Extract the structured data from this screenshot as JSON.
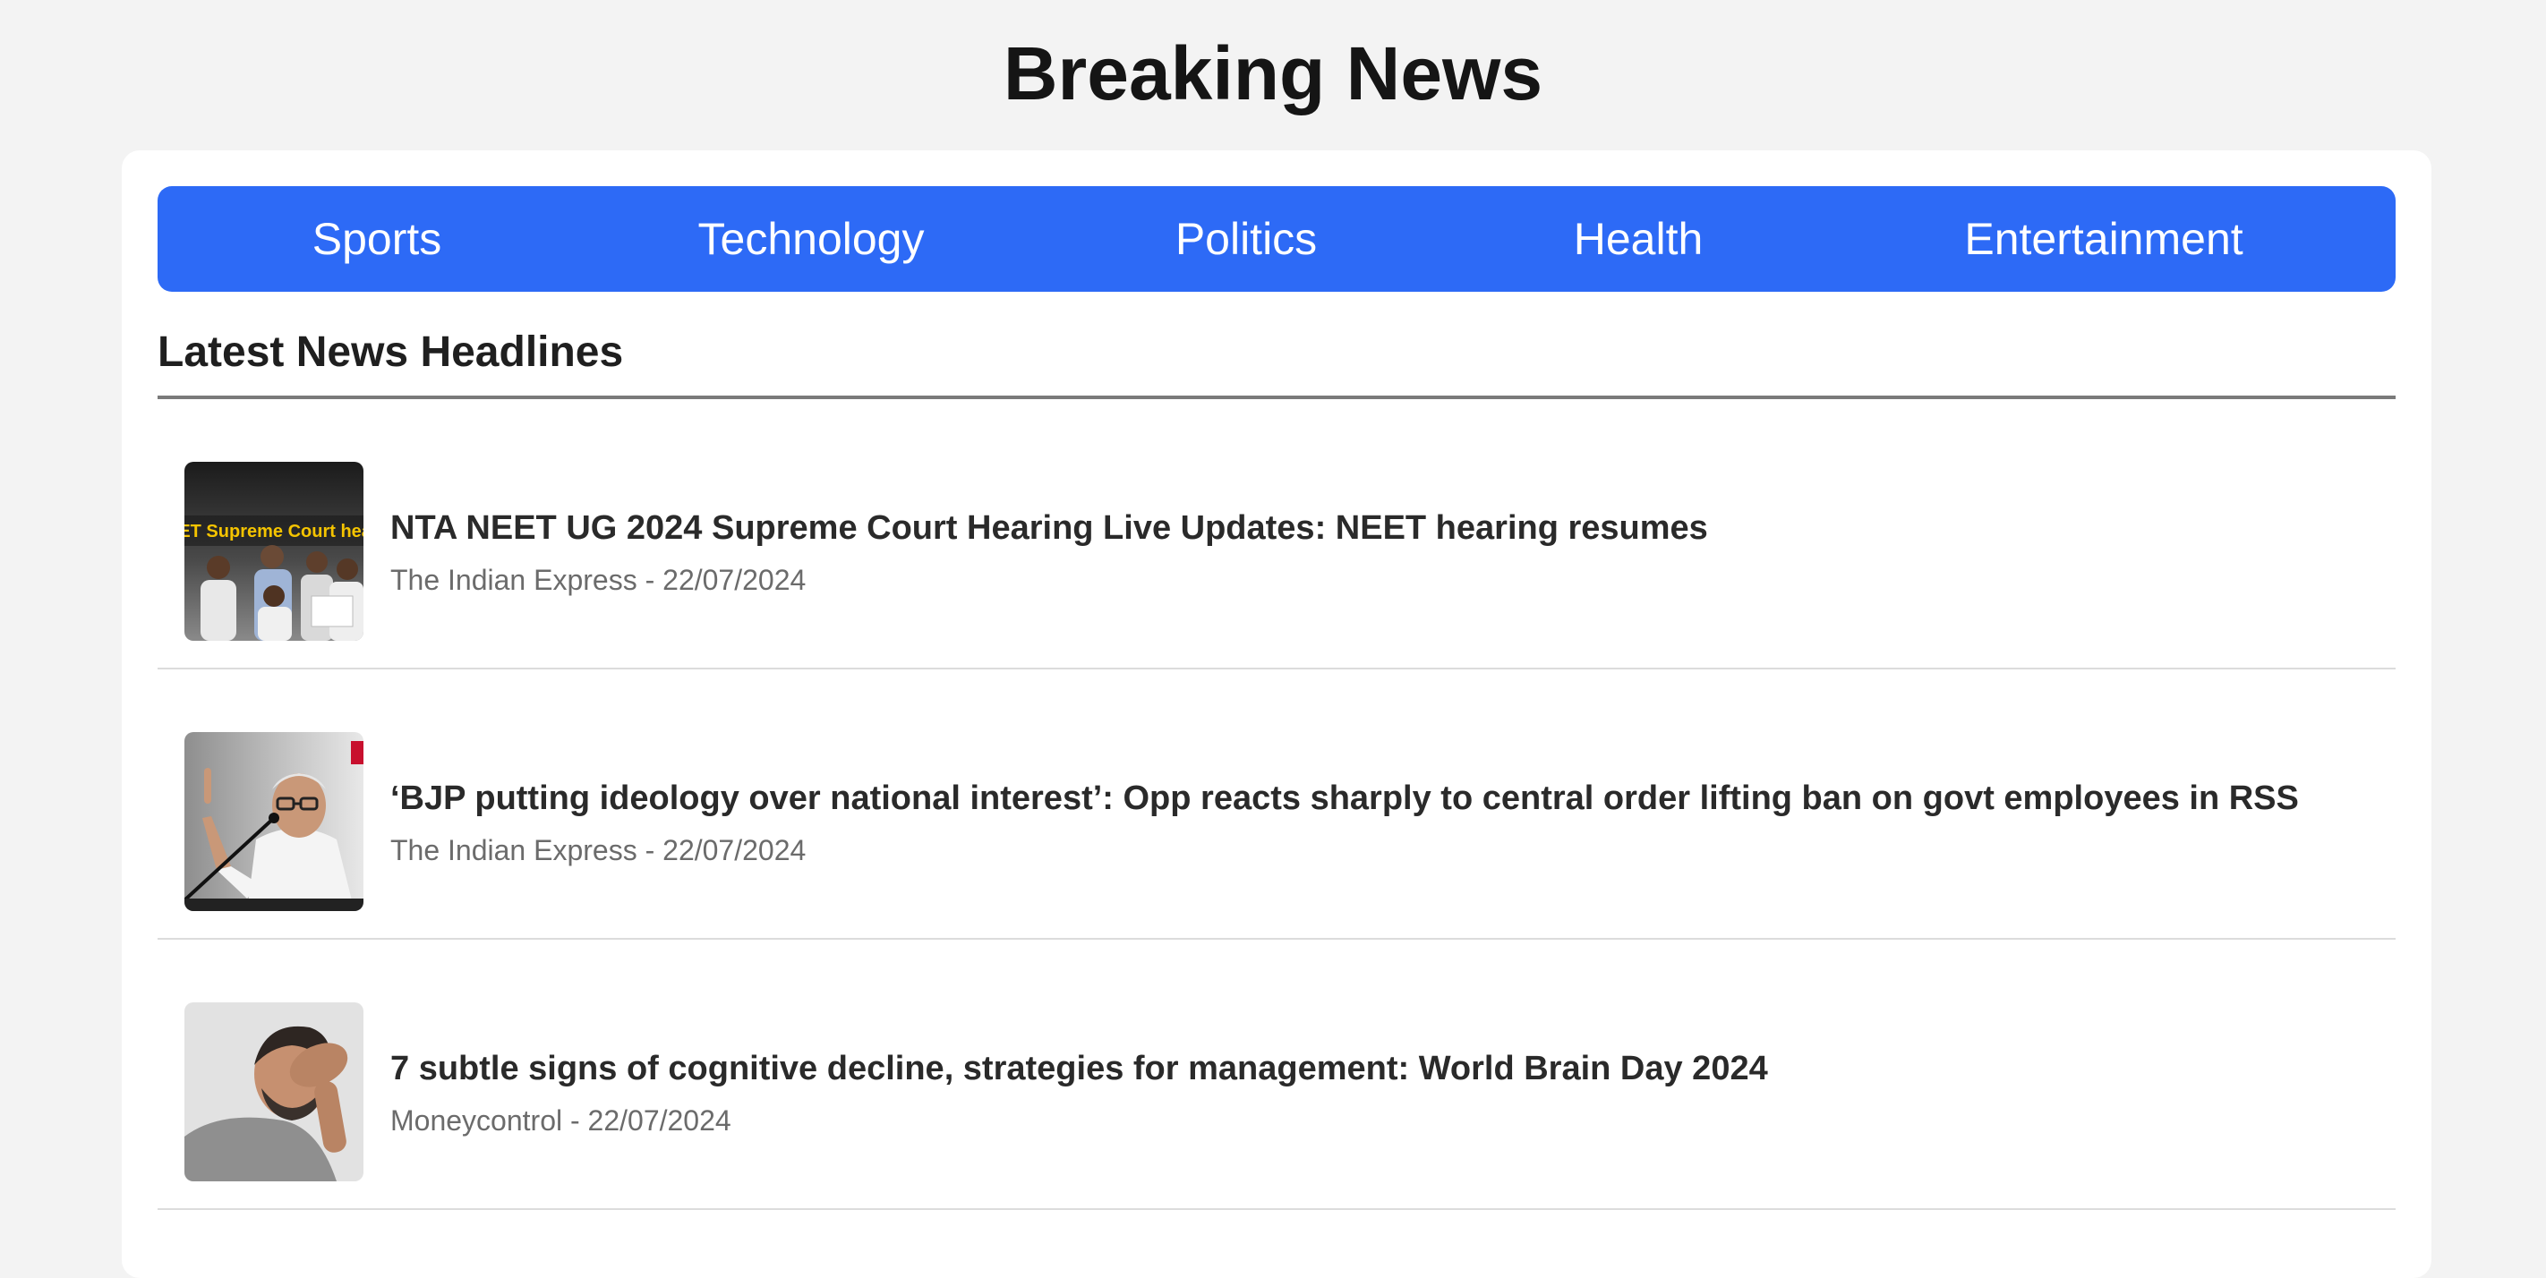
{
  "page": {
    "title": "Breaking News"
  },
  "nav": {
    "items": [
      {
        "label": "Sports"
      },
      {
        "label": "Technology"
      },
      {
        "label": "Politics"
      },
      {
        "label": "Health"
      },
      {
        "label": "Entertainment"
      }
    ]
  },
  "section": {
    "heading": "Latest News Headlines"
  },
  "news": [
    {
      "headline": "NTA NEET UG 2024 Supreme Court Hearing Live Updates: NEET hearing resumes",
      "source": "The Indian Express",
      "separator": " - ",
      "date": "22/07/2024",
      "thumbnail_icon": "protest-photo",
      "thumbnail_caption": "NEET Supreme Court hearin"
    },
    {
      "headline": "‘BJP putting ideology over national interest’: Opp reacts sharply to central order lifting ban on govt employees in RSS",
      "source": "The Indian Express",
      "separator": " - ",
      "date": "22/07/2024",
      "thumbnail_icon": "speaker-photo"
    },
    {
      "headline": "7 subtle signs of cognitive decline, strategies for management: World Brain Day 2024",
      "source": "Moneycontrol",
      "separator": " - ",
      "date": "22/07/2024",
      "thumbnail_icon": "headache-photo"
    }
  ],
  "colors": {
    "nav_background": "#2d6af6",
    "page_background": "#f3f3f3",
    "card_background": "#ffffff"
  }
}
